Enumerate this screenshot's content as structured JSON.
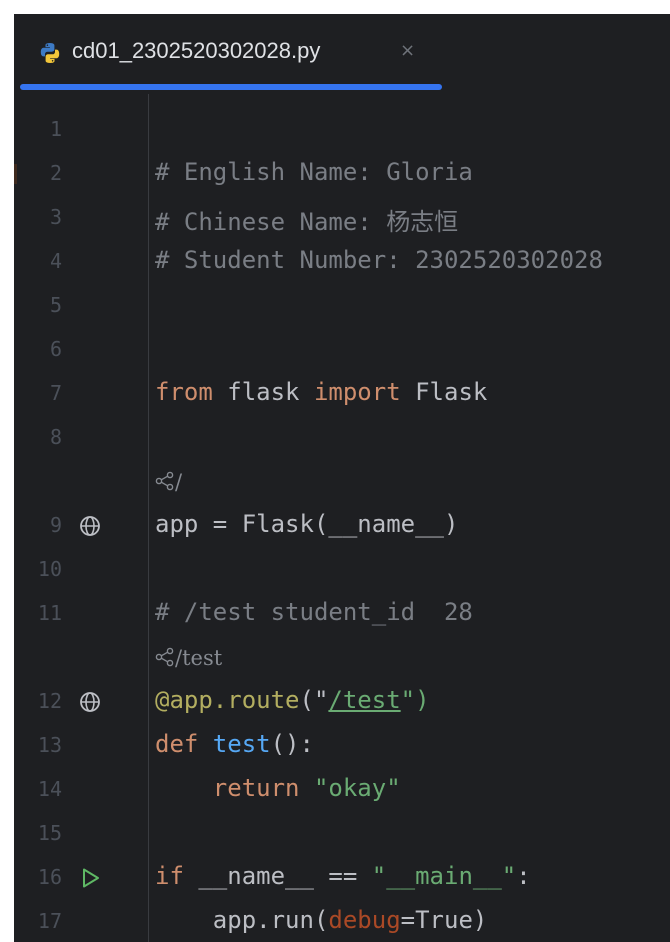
{
  "tab": {
    "title": "cd01_2302520302028.py",
    "close": "×",
    "icon": "python-file-icon"
  },
  "colors": {
    "background": "#1e1f22",
    "accent": "#3574f0",
    "keyword": "#cf8e6d",
    "string": "#6aab73",
    "comment": "#7a7e85",
    "function": "#56a8f5"
  },
  "lines": {
    "l1": "1",
    "l2": "2",
    "l3": "3",
    "l4": "4",
    "l5": "5",
    "l6": "6",
    "l7": "7",
    "l8": "8",
    "l9": "9",
    "l10": "10",
    "l11": "11",
    "l12": "12",
    "l13": "13",
    "l14": "14",
    "l15": "15",
    "l16": "16",
    "l17": "17"
  },
  "code": {
    "c2": "# English Name: Gloria",
    "c3": "# Chinese Name: 杨志恒",
    "c4": "# Student Number: 2302520302028",
    "c7_kw1": "from",
    "c7_mod": " flask ",
    "c7_kw2": "import",
    "c7_name": " Flask",
    "hint1": "/",
    "c9": "app = Flask(__name__)",
    "c11": "# /test student_id  28",
    "hint2": "/test",
    "c12_dec": "@app.route",
    "c12_open": "(\"",
    "c12_route": "/test",
    "c12_close": "\")",
    "c13_kw": "def",
    "c13_fn": " test",
    "c13_rest": "():",
    "c14_kw": "    return",
    "c14_str": " \"okay\"",
    "c16_kw": "if",
    "c16_mid": " __name__ == ",
    "c16_str": "\"__main__\"",
    "c16_end": ":",
    "c17_a": "    app.run(",
    "c17_prm": "debug",
    "c17_b": "=True)"
  },
  "gutter_icons": {
    "l9": "web-endpoint-icon",
    "l12": "web-endpoint-icon",
    "l16": "run-icon"
  }
}
